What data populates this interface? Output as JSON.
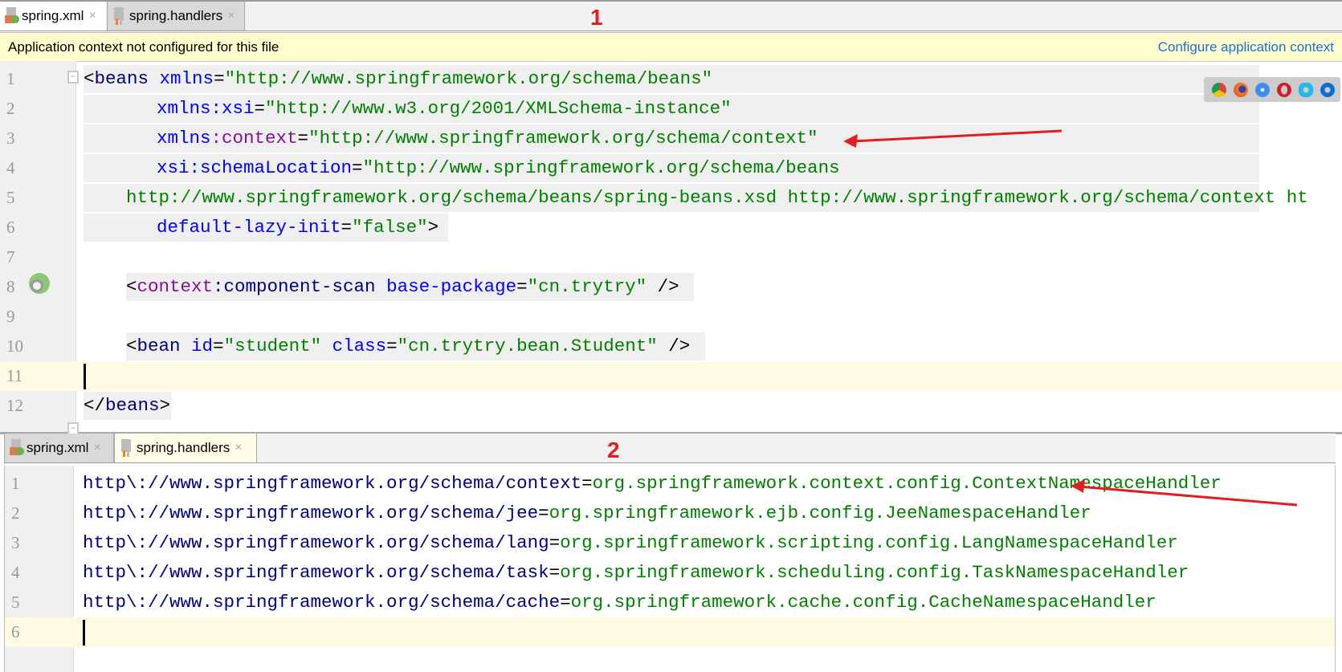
{
  "top_panel": {
    "tabs": [
      {
        "label": "spring.xml",
        "close": "×",
        "active": true
      },
      {
        "label": "spring.handlers",
        "close": "×",
        "active": false
      }
    ],
    "annotation": "1",
    "info_bar": {
      "message": "Application context not configured for this file",
      "link": "Configure application context"
    },
    "browser_icons": [
      "chrome-icon",
      "firefox-icon",
      "safari-icon",
      "opera-icon",
      "ie-icon",
      "edge-icon"
    ],
    "lines": [
      {
        "n": "1",
        "tokens": [
          [
            "<",
            "pun"
          ],
          [
            "beans",
            "tag"
          ],
          [
            " ",
            "pun"
          ],
          [
            "xmlns",
            "attr"
          ],
          [
            "=",
            "pun"
          ],
          [
            "\"http://www.springframework.org/schema/beans\"",
            "val"
          ]
        ]
      },
      {
        "n": "2",
        "tokens": [
          [
            "xmlns",
            "attr"
          ],
          [
            ":xsi",
            "attr"
          ],
          [
            "=",
            "pun"
          ],
          [
            "\"http://www.w3.org/2001/XMLSchema-instance\"",
            "val"
          ]
        ]
      },
      {
        "n": "3",
        "tokens": [
          [
            "xmlns",
            "attr"
          ],
          [
            ":context",
            "ns"
          ],
          [
            "=",
            "pun"
          ],
          [
            "\"http://www.springframework.org/schema/context\"",
            "val"
          ]
        ]
      },
      {
        "n": "4",
        "tokens": [
          [
            "xsi:schemaLocation",
            "attr"
          ],
          [
            "=",
            "pun"
          ],
          [
            "\"http://www.springframework.org/schema/beans",
            "val"
          ]
        ]
      },
      {
        "n": "5",
        "tokens": [
          [
            "http://www.springframework.org/schema/beans/spring-beans.xsd http://www.springframework.org/schema/context ht",
            "val"
          ]
        ]
      },
      {
        "n": "6",
        "tokens": [
          [
            "default-lazy-init",
            "attr"
          ],
          [
            "=",
            "pun"
          ],
          [
            "\"false\"",
            "val"
          ],
          [
            ">",
            "pun"
          ]
        ]
      },
      {
        "n": "7",
        "tokens": []
      },
      {
        "n": "8",
        "tokens": [
          [
            "<",
            "pun"
          ],
          [
            "context",
            "ns"
          ],
          [
            ":component-scan",
            "tag"
          ],
          [
            " ",
            "pun"
          ],
          [
            "base-package",
            "attr"
          ],
          [
            "=",
            "pun"
          ],
          [
            "\"cn.trytry\"",
            "val"
          ],
          [
            " />",
            "pun"
          ]
        ]
      },
      {
        "n": "9",
        "tokens": []
      },
      {
        "n": "10",
        "tokens": [
          [
            "<",
            "pun"
          ],
          [
            "bean",
            "tag"
          ],
          [
            " ",
            "pun"
          ],
          [
            "id",
            "attr"
          ],
          [
            "=",
            "pun"
          ],
          [
            "\"student\"",
            "val"
          ],
          [
            " ",
            "pun"
          ],
          [
            "class",
            "attr"
          ],
          [
            "=",
            "pun"
          ],
          [
            "\"cn.trytry.bean.Student\"",
            "val"
          ],
          [
            " />",
            "pun"
          ]
        ]
      },
      {
        "n": "11",
        "tokens": []
      },
      {
        "n": "12",
        "tokens": [
          [
            "</",
            "pun"
          ],
          [
            "beans",
            "tag"
          ],
          [
            ">",
            "pun"
          ]
        ]
      }
    ]
  },
  "bottom_panel": {
    "tabs": [
      {
        "label": "spring.xml",
        "close": "×",
        "active": false
      },
      {
        "label": "spring.handlers",
        "close": "×",
        "active": true
      }
    ],
    "annotation": "2",
    "lines": [
      {
        "n": "1",
        "tokens": [
          [
            "http\\://www.springframework.org/schema/context",
            "key"
          ],
          [
            "=",
            "pun"
          ],
          [
            "org.springframework.context.config.ContextNamespaceHandler",
            "val"
          ]
        ]
      },
      {
        "n": "2",
        "tokens": [
          [
            "http\\://www.springframework.org/schema/jee",
            "key"
          ],
          [
            "=",
            "pun"
          ],
          [
            "org.springframework.ejb.config.JeeNamespaceHandler",
            "val"
          ]
        ]
      },
      {
        "n": "3",
        "tokens": [
          [
            "http\\://www.springframework.org/schema/lang",
            "key"
          ],
          [
            "=",
            "pun"
          ],
          [
            "org.springframework.scripting.config.LangNamespaceHandler",
            "val"
          ]
        ]
      },
      {
        "n": "4",
        "tokens": [
          [
            "http\\://www.springframework.org/schema/task",
            "key"
          ],
          [
            "=",
            "pun"
          ],
          [
            "org.springframework.scheduling.config.TaskNamespaceHandler",
            "val"
          ]
        ]
      },
      {
        "n": "5",
        "tokens": [
          [
            "http\\://www.springframework.org/schema/cache",
            "key"
          ],
          [
            "=",
            "pun"
          ],
          [
            "org.springframework.cache.config.CacheNamespaceHandler",
            "val"
          ]
        ]
      },
      {
        "n": "6",
        "tokens": []
      }
    ]
  },
  "colors": {
    "tag": "#000080",
    "attribute": "#0000ff",
    "value": "#008000",
    "namespace": "#871094",
    "annotation": "#e02020",
    "current_line": "#fffae3"
  }
}
